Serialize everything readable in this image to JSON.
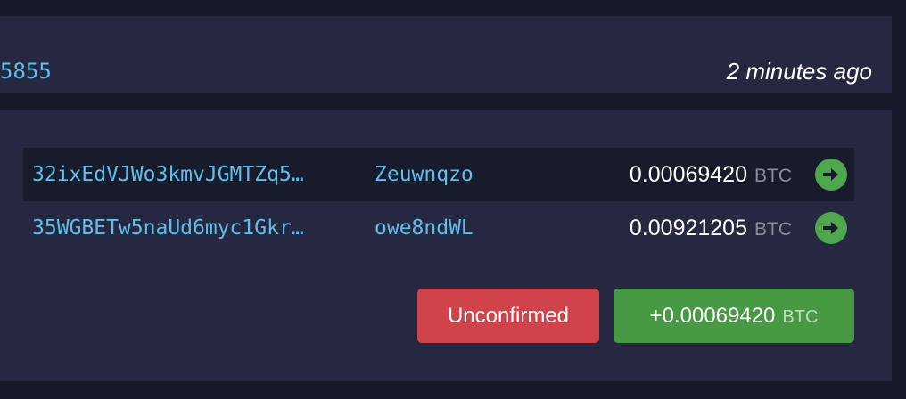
{
  "transaction": {
    "txid_visible": "5855",
    "time": "2 minutes ago"
  },
  "outputs": [
    {
      "address": "32ixEdVJWo3kmvJGMTZq5…",
      "label": "Zeuwnqzo",
      "amount": "0.00069420",
      "unit": "BTC",
      "icon": "arrow-right-icon"
    },
    {
      "address": "35WGBETw5naUd6myc1Gkr…",
      "label": "owe8ndWL",
      "amount": "0.00921205",
      "unit": "BTC",
      "icon": "arrow-right-icon"
    }
  ],
  "status": {
    "label": "Unconfirmed",
    "color": "#d0434a"
  },
  "total": {
    "amount": "+0.00069420",
    "unit": "BTC",
    "color": "#479a43"
  },
  "colors": {
    "background": "#171a2a",
    "card": "#252840",
    "highlight_row": "#181b2c",
    "link": "#5ebfe8",
    "arrow": "#4ea74c"
  }
}
